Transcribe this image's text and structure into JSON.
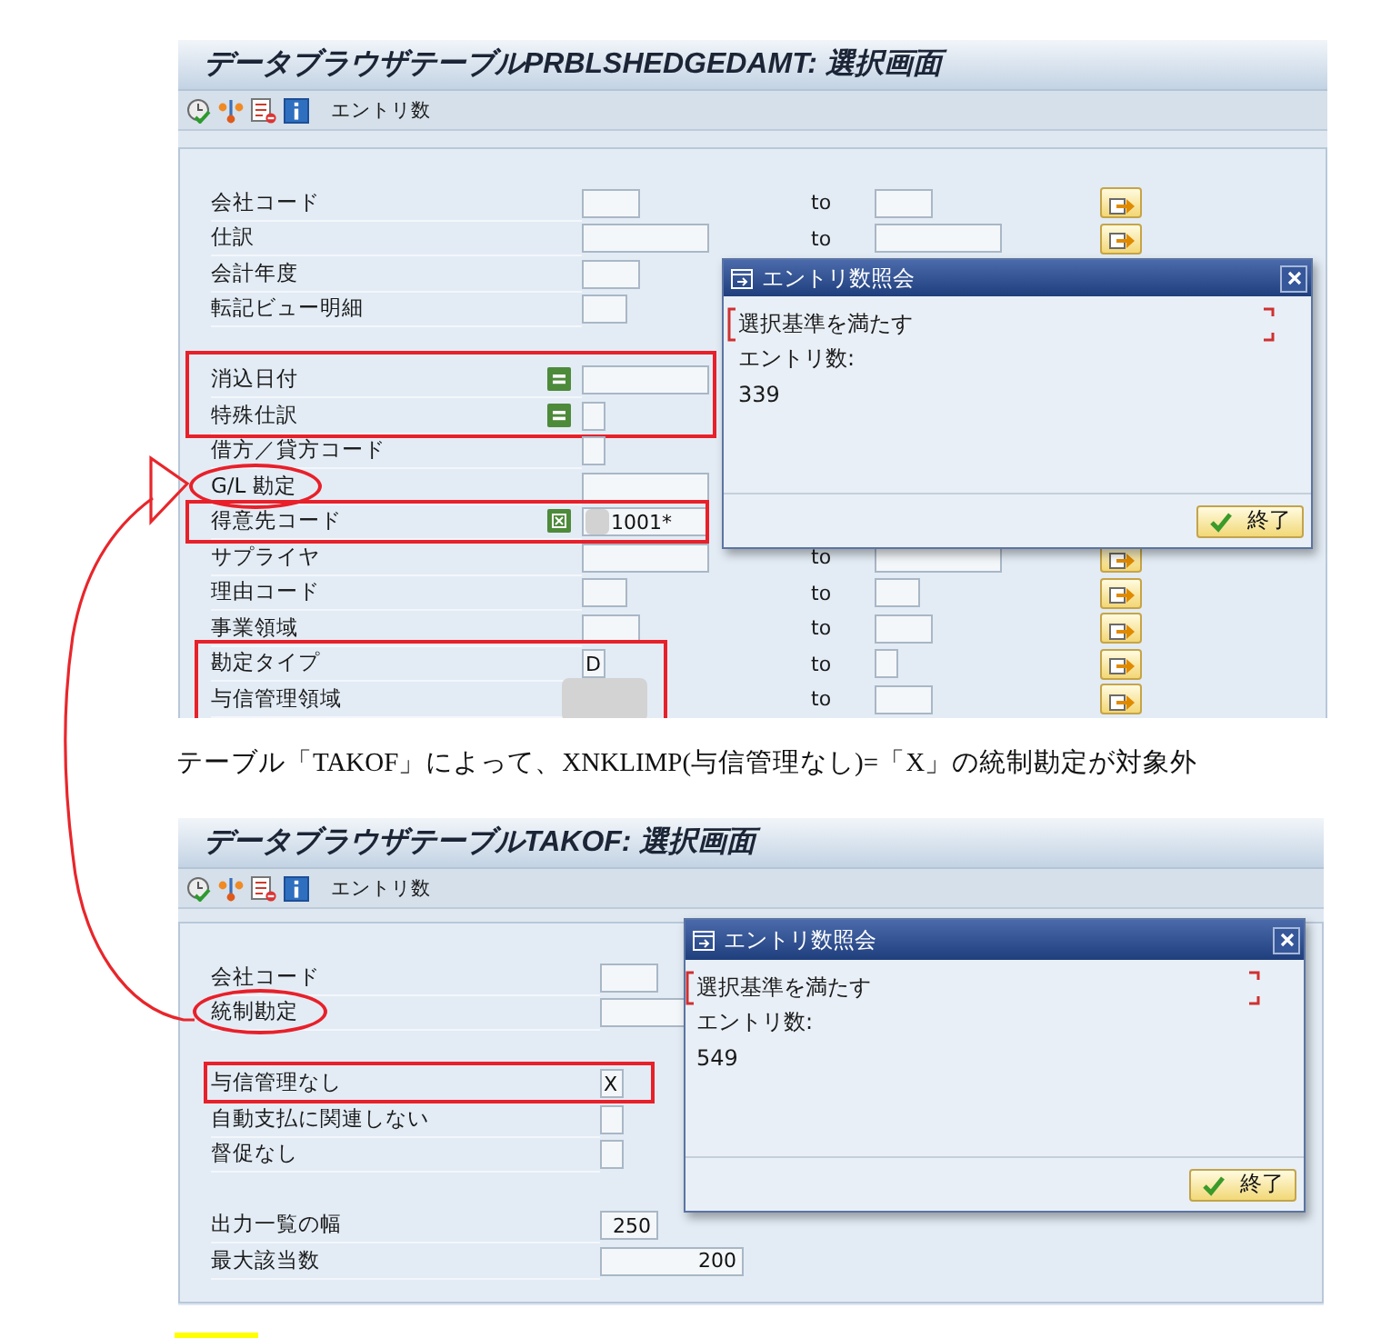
{
  "upper_screen": {
    "title": "データブラウザテーブルPRBLSHEDGEDAMT: 選択画面",
    "toolbar": {
      "button": "エントリ数"
    },
    "sections": [
      {
        "groups": [
          {
            "kind": "plain",
            "rows": [
              {
                "kind": "plain",
                "label": "会社コード",
                "to": "to",
                "multi_select": true
              },
              {
                "kind": "plain",
                "label": "仕訳",
                "to": "to",
                "multi_select": true
              },
              {
                "kind": "plain",
                "label": "会計年度"
              },
              {
                "kind": "plain",
                "label": "転記ビュー明細"
              }
            ]
          }
        ]
      },
      {
        "groups": [
          {
            "kind": "framed",
            "rows": [
              {
                "kind": "equals",
                "label": "消込日付"
              },
              {
                "kind": "equals",
                "label": "特殊仕訳"
              }
            ]
          },
          {
            "kind": "plain",
            "rows": [
              {
                "kind": "plain",
                "label": "借方／貸方コード"
              }
            ]
          },
          {
            "kind": "circled",
            "rows": [
              {
                "kind": "plain",
                "label": "G/L 勘定"
              }
            ]
          },
          {
            "kind": "framed",
            "rows": [
              {
                "kind": "exclude",
                "label": "得意先コード",
                "value": "1001*",
                "redacted": true
              }
            ]
          },
          {
            "kind": "plain",
            "rows": [
              {
                "kind": "plain",
                "label": "サプライヤ",
                "to": "to",
                "multi_select": true
              },
              {
                "kind": "plain",
                "label": "理由コード",
                "to": "to",
                "multi_select": true
              },
              {
                "kind": "plain",
                "label": "事業領域",
                "to": "to",
                "multi_select": true
              }
            ]
          },
          {
            "kind": "framed",
            "rows": [
              {
                "kind": "plain",
                "label": "勘定タイプ",
                "value": "D",
                "to": "to",
                "multi_select": true
              },
              {
                "kind": "plain",
                "label": "与信管理領域",
                "redacted": true,
                "to": "to",
                "multi_select": true
              }
            ]
          }
        ]
      }
    ],
    "dialog": {
      "title": "エントリ数照会",
      "criteria": "選択基準を満たす",
      "count_label": "エントリ数:",
      "count": "339",
      "button": "終了"
    }
  },
  "caption": "テーブル「TAKOF」によって、XNKLIMP(与信管理なし)=「X」の統制勘定が対象外",
  "lower_screen": {
    "title": "データブラウザテーブルTAKOF: 選択画面",
    "toolbar": {
      "button": "エントリ数"
    },
    "sections": [
      {
        "groups": [
          {
            "kind": "plain",
            "rows": [
              {
                "label": "会社コード"
              }
            ]
          },
          {
            "kind": "circled",
            "rows": [
              {
                "label": "統制勘定"
              }
            ]
          }
        ]
      },
      {
        "groups": [
          {
            "kind": "framed",
            "rows": [
              {
                "label": "与信管理なし",
                "value": "X"
              }
            ]
          },
          {
            "kind": "plain",
            "rows": [
              {
                "label": "自動支払に関連しない"
              },
              {
                "label": "督促なし"
              }
            ]
          }
        ]
      },
      {
        "groups": [
          {
            "kind": "plain",
            "rows": [
              {
                "label": "出力一覧の幅",
                "value": "250"
              },
              {
                "label": "最大該当数",
                "value": "200"
              }
            ]
          }
        ]
      }
    ],
    "dialog": {
      "title": "エントリ数照会",
      "criteria": "選択基準を満たす",
      "count_label": "エントリ数:",
      "count": "549",
      "button": "終了"
    }
  },
  "connector": {
    "kind": "curved-arrow"
  },
  "highlight": {
    "kind": "marker"
  }
}
